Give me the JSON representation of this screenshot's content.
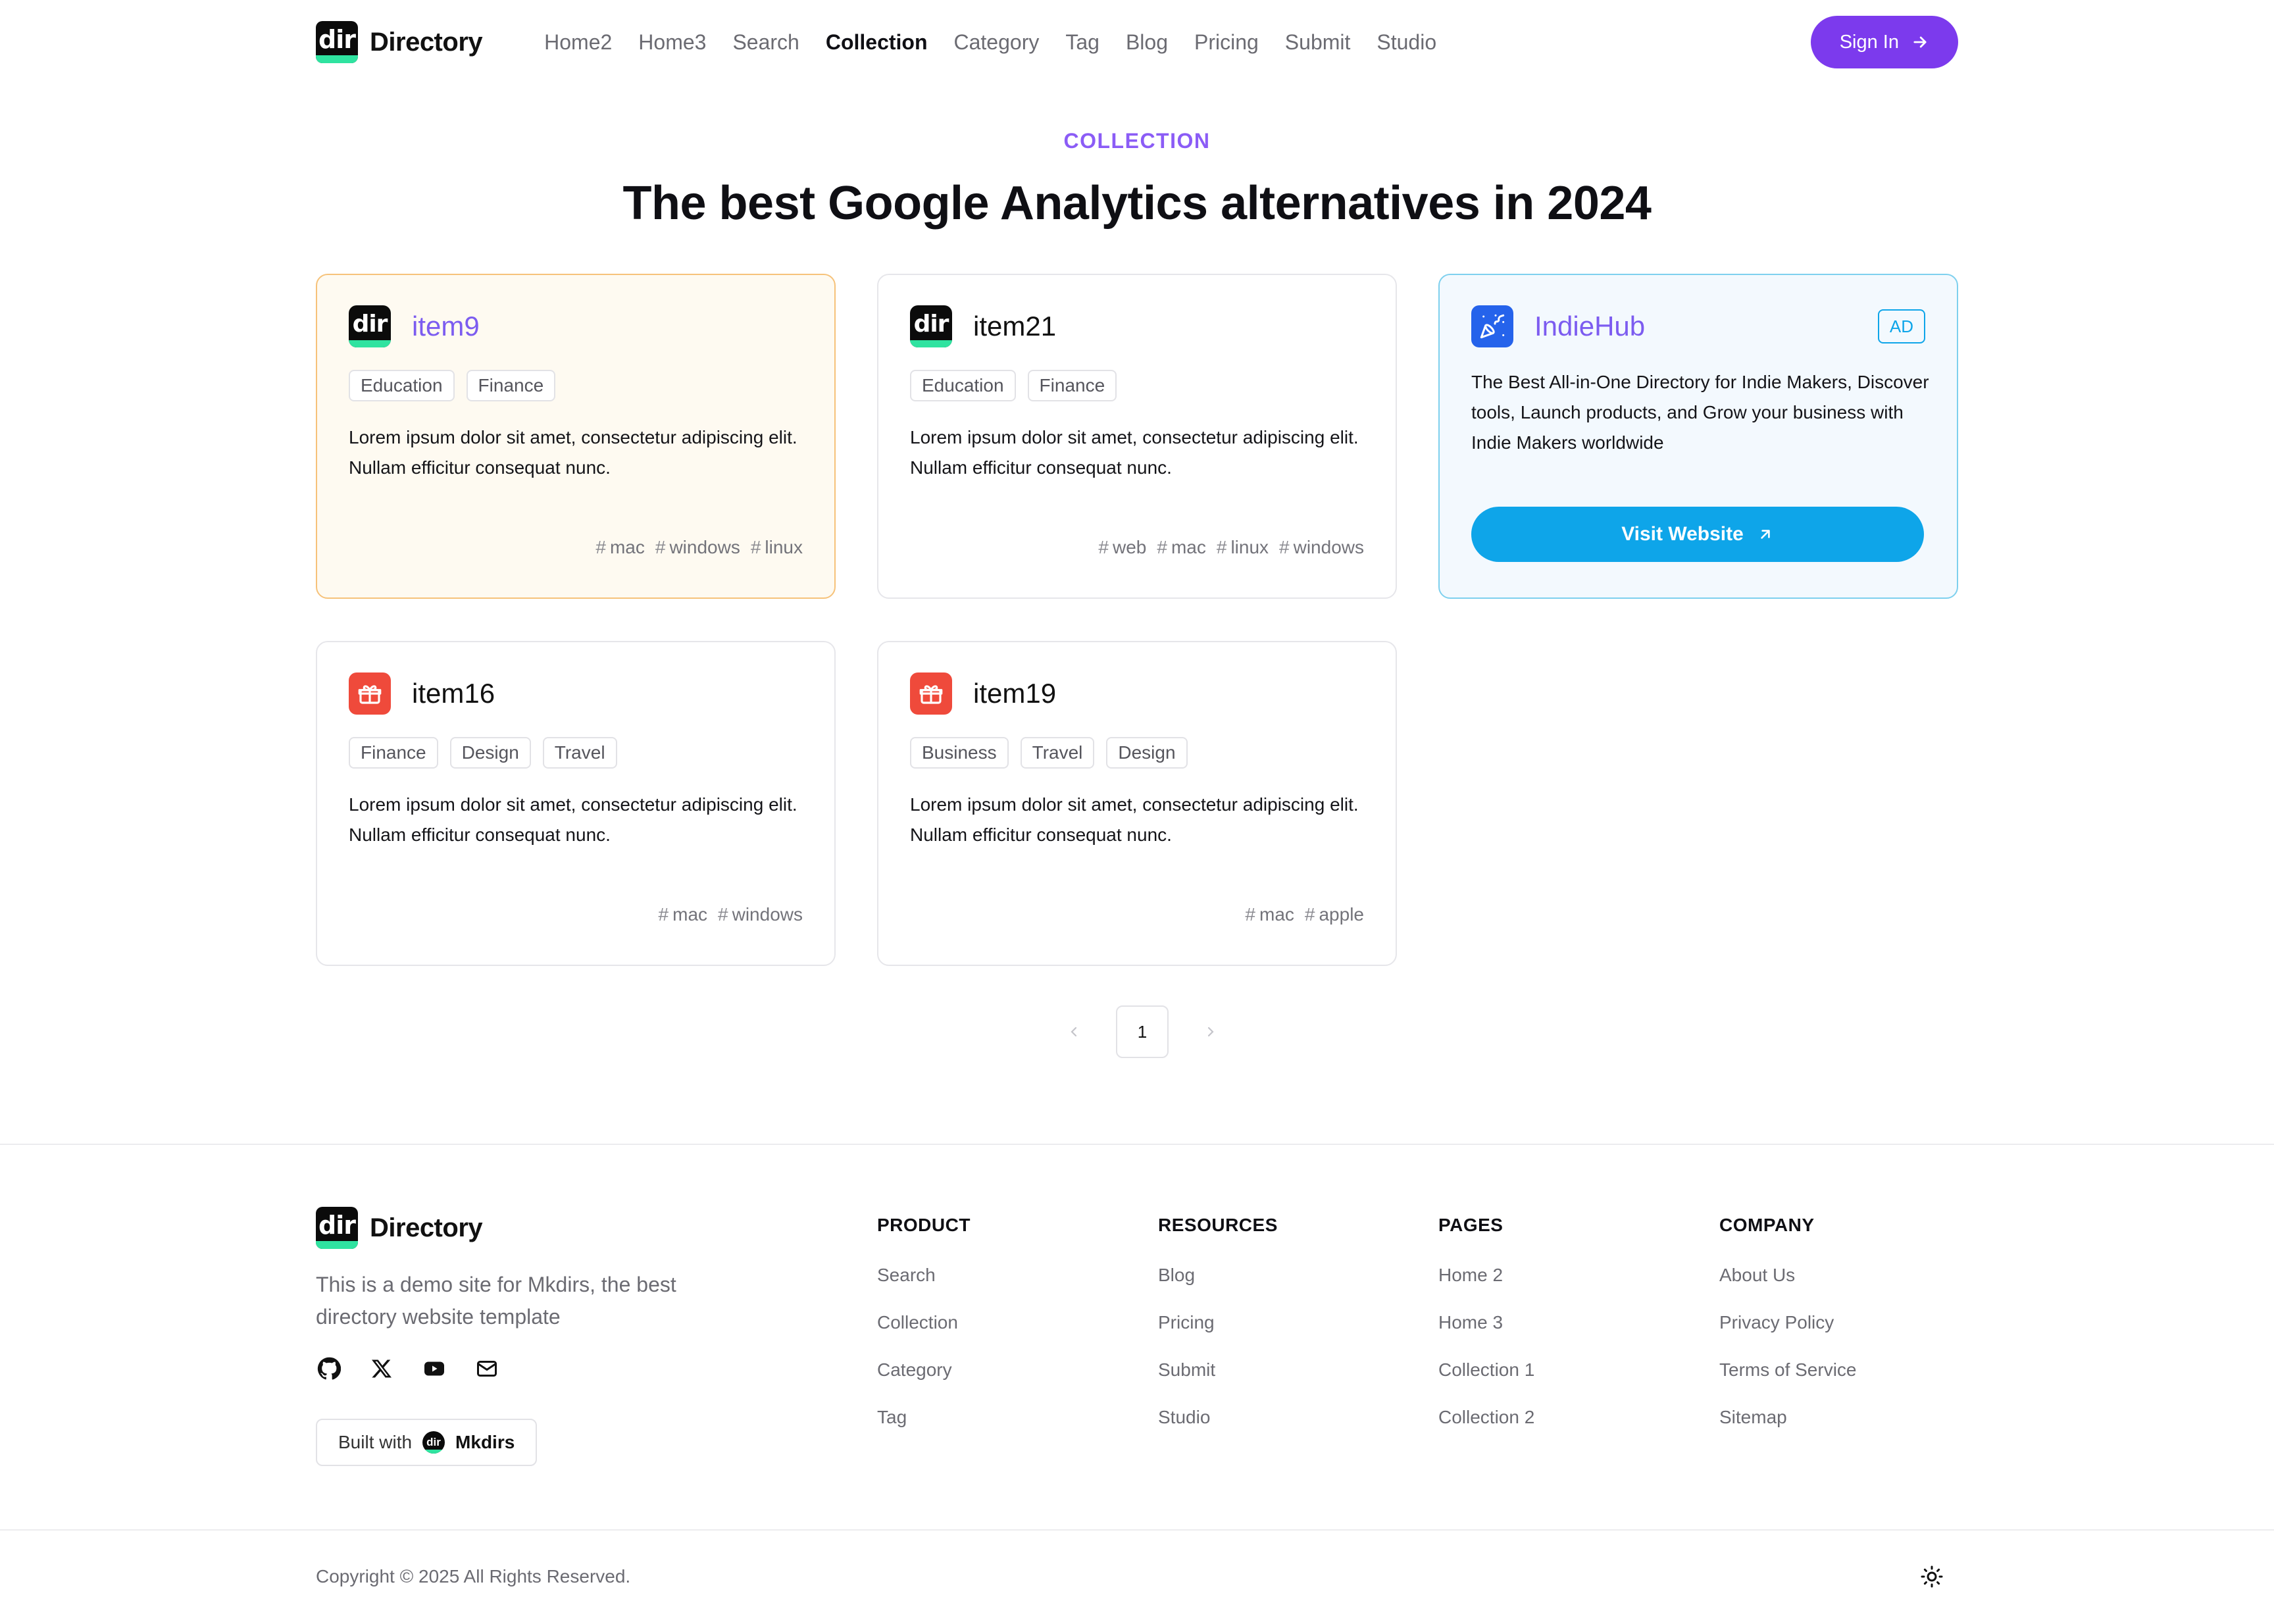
{
  "header": {
    "brand": "Directory",
    "logo_text": "dir",
    "nav": [
      "Home2",
      "Home3",
      "Search",
      "Collection",
      "Category",
      "Tag",
      "Blog",
      "Pricing",
      "Submit",
      "Studio"
    ],
    "active_nav": "Collection",
    "sign_in": "Sign In"
  },
  "hero": {
    "eyebrow": "COLLECTION",
    "title": "The best Google Analytics alternatives in 2024"
  },
  "items": [
    {
      "name": "item9",
      "icon": "dir-logo-icon",
      "tags": [
        "Education",
        "Finance"
      ],
      "description": "Lorem ipsum dolor sit amet, consectetur adipiscing elit. Nullam efficitur consequat nunc.",
      "platforms": [
        "mac",
        "windows",
        "linux"
      ],
      "featured": true
    },
    {
      "name": "item21",
      "icon": "dir-logo-icon",
      "tags": [
        "Education",
        "Finance"
      ],
      "description": "Lorem ipsum dolor sit amet, consectetur adipiscing elit. Nullam efficitur consequat nunc.",
      "platforms": [
        "web",
        "mac",
        "linux",
        "windows"
      ],
      "featured": false
    },
    {
      "name": "item16",
      "icon": "gift-icon",
      "tags": [
        "Finance",
        "Design",
        "Travel"
      ],
      "description": "Lorem ipsum dolor sit amet, consectetur adipiscing elit. Nullam efficitur consequat nunc.",
      "platforms": [
        "mac",
        "windows"
      ],
      "featured": false
    },
    {
      "name": "item19",
      "icon": "gift-icon",
      "tags": [
        "Business",
        "Travel",
        "Design"
      ],
      "description": "Lorem ipsum dolor sit amet, consectetur adipiscing elit. Nullam efficitur consequat nunc.",
      "platforms": [
        "mac",
        "apple"
      ],
      "featured": false
    }
  ],
  "ad": {
    "name": "IndieHub",
    "badge": "AD",
    "icon": "party-popper-icon",
    "description": "The Best All-in-One Directory for Indie Makers, Discover tools, Launch products, and Grow your business with Indie Makers worldwide",
    "cta": "Visit Website"
  },
  "pagination": {
    "current": "1"
  },
  "footer": {
    "brand": "Directory",
    "about": "This is a demo site for Mkdirs, the best directory website template",
    "socials": [
      "github-icon",
      "x-icon",
      "youtube-icon",
      "mail-icon"
    ],
    "built_with": "Built with",
    "built_brand": "Mkdirs",
    "columns": [
      {
        "title": "PRODUCT",
        "links": [
          "Search",
          "Collection",
          "Category",
          "Tag"
        ]
      },
      {
        "title": "RESOURCES",
        "links": [
          "Blog",
          "Pricing",
          "Submit",
          "Studio"
        ]
      },
      {
        "title": "PAGES",
        "links": [
          "Home 2",
          "Home 3",
          "Collection 1",
          "Collection 2"
        ]
      },
      {
        "title": "COMPANY",
        "links": [
          "About Us",
          "Privacy Policy",
          "Terms of Service",
          "Sitemap"
        ]
      }
    ],
    "copyright": "Copyright © 2025 All Rights Reserved."
  },
  "colors": {
    "accent": "#7c3aed",
    "ad_accent": "#0ea5e9",
    "featured_border": "#f6c27a",
    "eyebrow": "#8b5cf6"
  }
}
